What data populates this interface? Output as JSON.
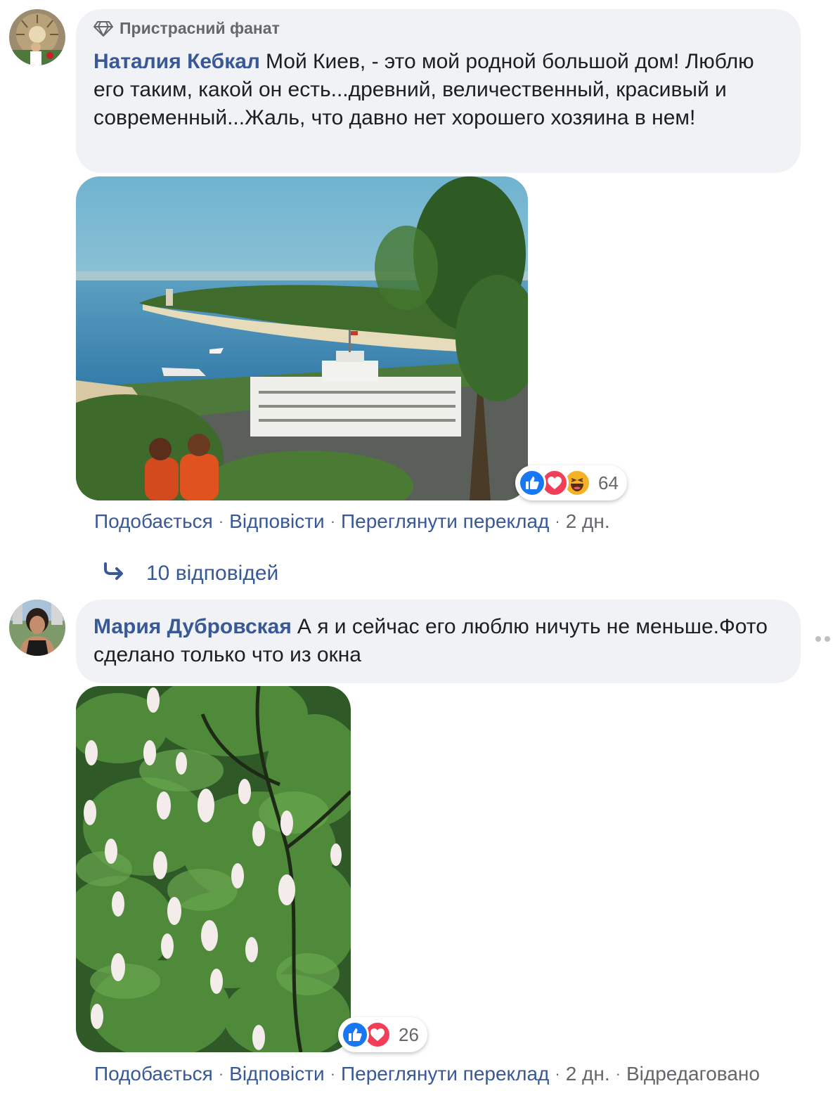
{
  "comments": [
    {
      "badge": "Пристрасний фанат",
      "author": "Наталия Кебкал",
      "text": "Мой Киев, - это мой родной большой дом! Люблю его таким, какой он есть...древний, величественный, красивый и современный...Жаль, что давно нет хорошего хозяина в нем!",
      "photo_icon": "kyiv-river-port-photo",
      "reaction_count": "64",
      "reactions": [
        "like-icon",
        "love-icon",
        "haha-icon"
      ],
      "actions": {
        "like": "Подобається",
        "reply": "Відповісти",
        "translate": "Переглянути переклад",
        "time": "2 дн."
      },
      "replies_label": "10 відповідей"
    },
    {
      "author": "Мария Дубровская",
      "text": "А я и сейчас его люблю ничуть не меньше.Фото сделано только что из окна",
      "photo_icon": "chestnut-blossom-photo",
      "reaction_count": "26",
      "reactions": [
        "like-icon",
        "love-icon"
      ],
      "actions": {
        "like": "Подобається",
        "reply": "Відповісти",
        "translate": "Переглянути переклад",
        "time": "2 дн.",
        "edited": "Відредаговано"
      }
    }
  ],
  "separator": "·",
  "colors": {
    "link": "#385898",
    "bubble": "#f0f2f5",
    "meta": "#65676b",
    "like": "#1877f2",
    "love": "#f33e58",
    "haha": "#f7b125"
  }
}
